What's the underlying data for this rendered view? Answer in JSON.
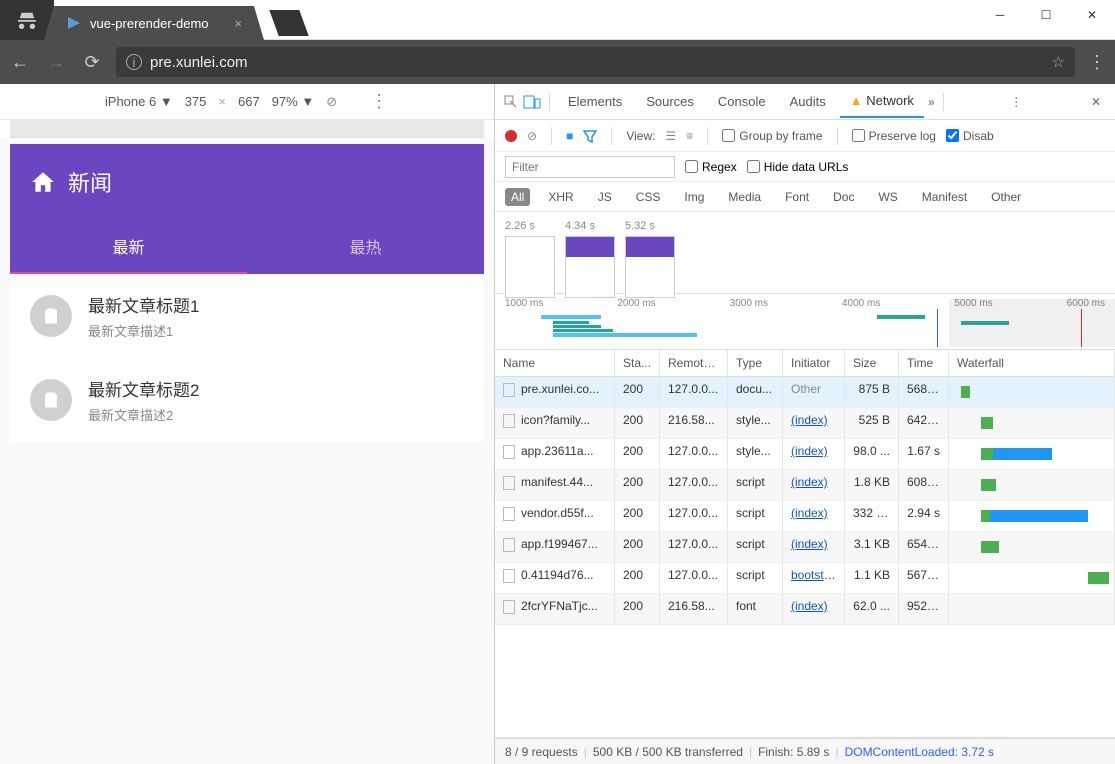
{
  "window": {
    "tab_title": "vue-prerender-demo"
  },
  "address": {
    "url": "pre.xunlei.com"
  },
  "device_bar": {
    "device": "iPhone 6 ▼",
    "w": "375",
    "h": "667",
    "zoom": "97% ▼"
  },
  "app": {
    "header_title": "新闻",
    "tabs": [
      {
        "label": "最新",
        "active": true
      },
      {
        "label": "最热",
        "active": false
      }
    ],
    "articles": [
      {
        "title": "最新文章标题1",
        "desc": "最新文章描述1"
      },
      {
        "title": "最新文章标题2",
        "desc": "最新文章描述2"
      }
    ]
  },
  "devtools": {
    "tabs": [
      "Elements",
      "Sources",
      "Console",
      "Audits",
      "Network"
    ],
    "active_tab": "Network",
    "toolbar": {
      "view_label": "View:",
      "group_by_frame": "Group by frame",
      "preserve_log": "Preserve log",
      "disable_cache": "Disab"
    },
    "filter": {
      "placeholder": "Filter",
      "regex": "Regex",
      "hide_urls": "Hide data URLs"
    },
    "types": [
      "All",
      "XHR",
      "JS",
      "CSS",
      "Img",
      "Media",
      "Font",
      "Doc",
      "WS",
      "Manifest",
      "Other"
    ],
    "filmstrip": [
      "2.26 s",
      "4.34 s",
      "5.32 s"
    ],
    "timeline_ticks": [
      "1000 ms",
      "2000 ms",
      "3000 ms",
      "4000 ms",
      "5000 ms",
      "6000 ms"
    ],
    "columns": [
      "Name",
      "Sta...",
      "Remote...",
      "Type",
      "Initiator",
      "Size",
      "Time",
      "Waterfall"
    ],
    "requests": [
      {
        "name": "pre.xunlei.co...",
        "status": "200",
        "remote": "127.0.0...",
        "type": "docu...",
        "initiator": "Other",
        "init_other": true,
        "size": "875 B",
        "time": "568 ...",
        "wf": {
          "l": 3,
          "w": 6,
          "c": "#4caf50"
        },
        "sel": true
      },
      {
        "name": "icon?family...",
        "status": "200",
        "remote": "216.58...",
        "type": "style...",
        "initiator": "(index)",
        "size": "525 B",
        "time": "642 ...",
        "wf": {
          "l": 16,
          "w": 8,
          "c": "#4caf50"
        }
      },
      {
        "name": "app.23611a...",
        "status": "200",
        "remote": "127.0.0...",
        "type": "style...",
        "initiator": "(index)",
        "size": "98.0 ...",
        "time": "1.67 s",
        "wf": {
          "l": 16,
          "w": 48,
          "c": "#2196f3",
          "g": 8
        }
      },
      {
        "name": "manifest.44...",
        "status": "200",
        "remote": "127.0.0...",
        "type": "script",
        "initiator": "(index)",
        "size": "1.8 KB",
        "time": "608 ...",
        "wf": {
          "l": 16,
          "w": 10,
          "c": "#4caf50"
        }
      },
      {
        "name": "vendor.d55f...",
        "status": "200",
        "remote": "127.0.0...",
        "type": "script",
        "initiator": "(index)",
        "size": "332 KB",
        "time": "2.94 s",
        "wf": {
          "l": 16,
          "w": 72,
          "c": "#2196f3",
          "g": 6
        }
      },
      {
        "name": "app.f199467...",
        "status": "200",
        "remote": "127.0.0...",
        "type": "script",
        "initiator": "(index)",
        "size": "3.1 KB",
        "time": "654 ...",
        "wf": {
          "l": 16,
          "w": 12,
          "c": "#4caf50"
        }
      },
      {
        "name": "0.41194d76...",
        "status": "200",
        "remote": "127.0.0...",
        "type": "script",
        "initiator": "bootstr...",
        "size": "1.1 KB",
        "time": "567 ...",
        "wf": {
          "l": 88,
          "w": 14,
          "c": "#4caf50"
        }
      },
      {
        "name": "2fcrYFNaTjc...",
        "status": "200",
        "remote": "216.58...",
        "type": "font",
        "initiator": "(index)",
        "size": "62.0 ...",
        "time": "952 ..."
      }
    ],
    "status": {
      "requests": "8 / 9 requests",
      "transferred": "500 KB / 500 KB transferred",
      "finish": "Finish: 5.89 s",
      "dcl": "DOMContentLoaded: 3.72 s"
    }
  }
}
